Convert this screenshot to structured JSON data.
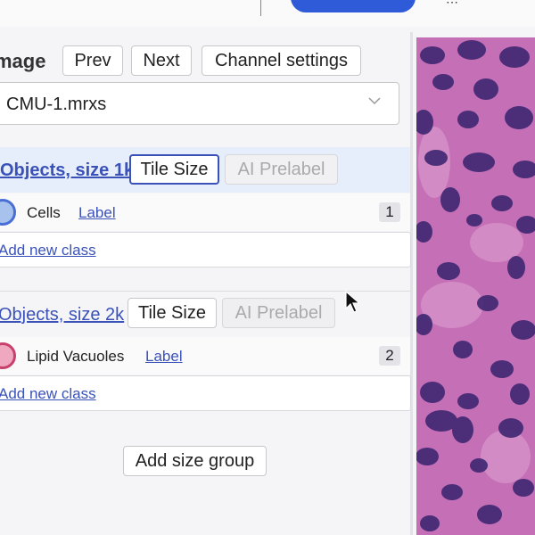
{
  "header": {
    "title_fragment": "... .. . ... .. . ...",
    "primary_color": "#2f5bd8"
  },
  "image_section": {
    "heading": "mage",
    "prev_label": "Prev",
    "next_label": "Next",
    "channel_settings_label": "Channel settings",
    "selected_image": "CMU-1.mrxs"
  },
  "size_groups": [
    {
      "title": "Objects, size 1k",
      "tile_size_label": "Tile Size",
      "ai_prelabel_label": "AI Prelabel",
      "classes": [
        {
          "name": "Cells",
          "label_link": "Label",
          "count": "1",
          "fill": "#a8c2ee",
          "border": "#4a6fd4"
        }
      ],
      "add_class_label": "Add new class"
    },
    {
      "title": "Objects, size 2k",
      "tile_size_label": "Tile Size",
      "ai_prelabel_label": "AI Prelabel",
      "classes": [
        {
          "name": "Lipid Vacuoles",
          "label_link": "Label",
          "count": "2",
          "fill": "#f0a8c0",
          "border": "#c8406c"
        }
      ],
      "add_class_label": "Add new class"
    }
  ],
  "add_size_group_label": "Add size group",
  "viewer": {
    "background": "#c46fb6",
    "nucleus_color": "#3b2470"
  },
  "icons": {
    "select_chevron": "chevron-down-icon",
    "cursor": "mouse-pointer-icon"
  }
}
